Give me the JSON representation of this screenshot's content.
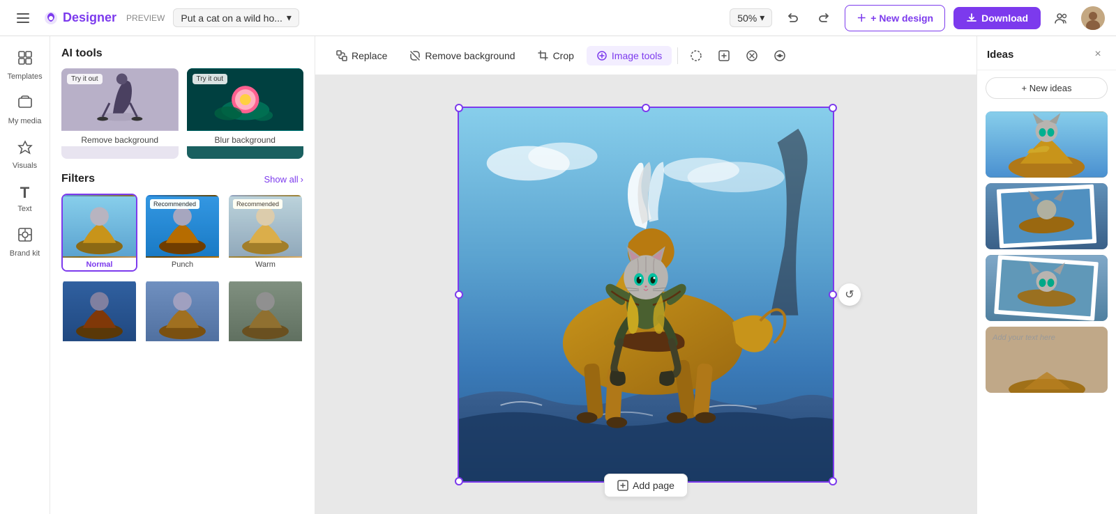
{
  "topbar": {
    "logo_text": "Designer",
    "preview_label": "PREVIEW",
    "project_title": "Put a cat on a wild ho...",
    "zoom_value": "50%",
    "new_design_label": "+ New design",
    "download_label": "Download"
  },
  "left_nav": {
    "items": [
      {
        "id": "templates",
        "icon": "⊞",
        "label": "Templates"
      },
      {
        "id": "my-media",
        "icon": "🖼",
        "label": "My media"
      },
      {
        "id": "visuals",
        "icon": "✦",
        "label": "Visuals"
      },
      {
        "id": "text",
        "icon": "T",
        "label": "Text"
      },
      {
        "id": "brand-kit",
        "icon": "◈",
        "label": "Brand kit"
      }
    ]
  },
  "ai_tools": {
    "section_title": "AI tools",
    "items": [
      {
        "label": "Remove background",
        "badge": "Try it out"
      },
      {
        "label": "Blur background",
        "badge": "Try it out"
      }
    ]
  },
  "filters": {
    "section_title": "Filters",
    "show_all_label": "Show all",
    "items": [
      {
        "label": "Normal",
        "active": true,
        "recommended": false
      },
      {
        "label": "Punch",
        "active": false,
        "recommended": true
      },
      {
        "label": "Warm",
        "active": false,
        "recommended": true
      },
      {
        "label": "",
        "active": false,
        "recommended": false
      },
      {
        "label": "",
        "active": false,
        "recommended": false
      },
      {
        "label": "",
        "active": false,
        "recommended": false
      }
    ]
  },
  "toolbar": {
    "replace_label": "Replace",
    "remove_bg_label": "Remove background",
    "crop_label": "Crop",
    "image_tools_label": "Image tools"
  },
  "canvas": {
    "zoom_level": "50%",
    "add_page_label": "Add page"
  },
  "right_panel": {
    "title": "Ideas",
    "new_ideas_label": "+ New ideas",
    "close_label": "×",
    "idea_4_text": "Add your text here"
  }
}
